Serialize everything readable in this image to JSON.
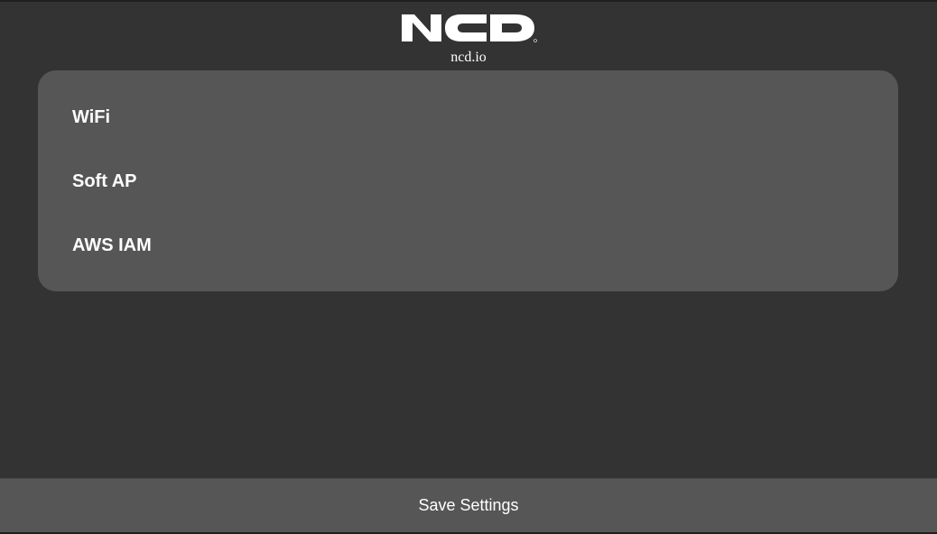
{
  "header": {
    "logo_icon": "ncd-logo-icon",
    "logo_text": "NCD",
    "site_link": "ncd.io"
  },
  "menu": {
    "items": [
      {
        "label": "WiFi"
      },
      {
        "label": "Soft AP"
      },
      {
        "label": "AWS IAM"
      }
    ]
  },
  "footer": {
    "save_label": "Save Settings"
  },
  "colors": {
    "background": "#333333",
    "panel": "#565656",
    "text": "#ffffff"
  }
}
